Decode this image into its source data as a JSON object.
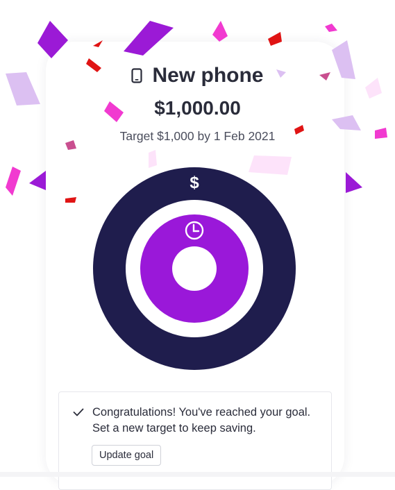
{
  "goal": {
    "title": "New phone",
    "icon": "mobile-phone-icon",
    "amount": "$1,000.00",
    "target_text": "Target $1,000 by 1 Feb 2021"
  },
  "progress": {
    "outer_ring_icon": "dollar-icon",
    "outer_ring_label": "$",
    "outer_ring_color": "#1f1d4d",
    "inner_ring_icon": "clock-icon",
    "inner_ring_color": "#9a18d9",
    "saved_fraction": 1.0,
    "time_fraction": 1.0
  },
  "notice": {
    "icon": "checkmark-icon",
    "message": "Congratulations! You've reached your goal. Set a new target to keep saving.",
    "button_label": "Update goal"
  },
  "colors": {
    "confetti_purple": "#9b1ad6",
    "confetti_pink": "#f13ad0",
    "confetti_lilac": "#dcc0f2",
    "confetti_red": "#e01414",
    "confetti_mauve": "#c94f8f",
    "confetti_lightpink": "#fde3fa"
  }
}
